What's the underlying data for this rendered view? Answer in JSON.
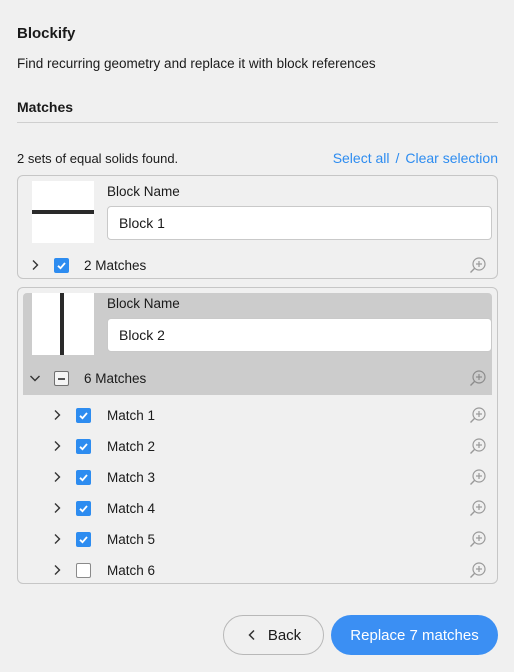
{
  "header": {
    "title": "Blockify",
    "subtitle": "Find recurring geometry and replace it with block references"
  },
  "section": {
    "title": "Matches"
  },
  "summary": {
    "text": "2 sets of equal solids found.",
    "select_all": "Select all",
    "separator": "/",
    "clear_selection": "Clear selection"
  },
  "blocks": [
    {
      "field_label": "Block Name",
      "name": "Block 1",
      "matches_label": "2 Matches",
      "expanded": false,
      "checked": "checked"
    },
    {
      "field_label": "Block Name",
      "name": "Block 2",
      "matches_label": "6 Matches",
      "expanded": true,
      "checked": "partial",
      "matches": [
        {
          "label": "Match 1",
          "checked": true
        },
        {
          "label": "Match 2",
          "checked": true
        },
        {
          "label": "Match 3",
          "checked": true
        },
        {
          "label": "Match 4",
          "checked": true
        },
        {
          "label": "Match 5",
          "checked": true
        },
        {
          "label": "Match 6",
          "checked": false
        }
      ]
    }
  ],
  "footer": {
    "back_label": "Back",
    "primary_label": "Replace 7 matches"
  },
  "colors": {
    "accent": "#2d8cf0",
    "primary_button": "#3b8ff3",
    "selected_row": "#cccccc",
    "background": "#f0f0f0"
  },
  "icons": {
    "zoom": "zoom-in-icon",
    "expand": "chevron-right-icon",
    "collapse": "chevron-down-icon",
    "back": "chevron-left-icon"
  }
}
